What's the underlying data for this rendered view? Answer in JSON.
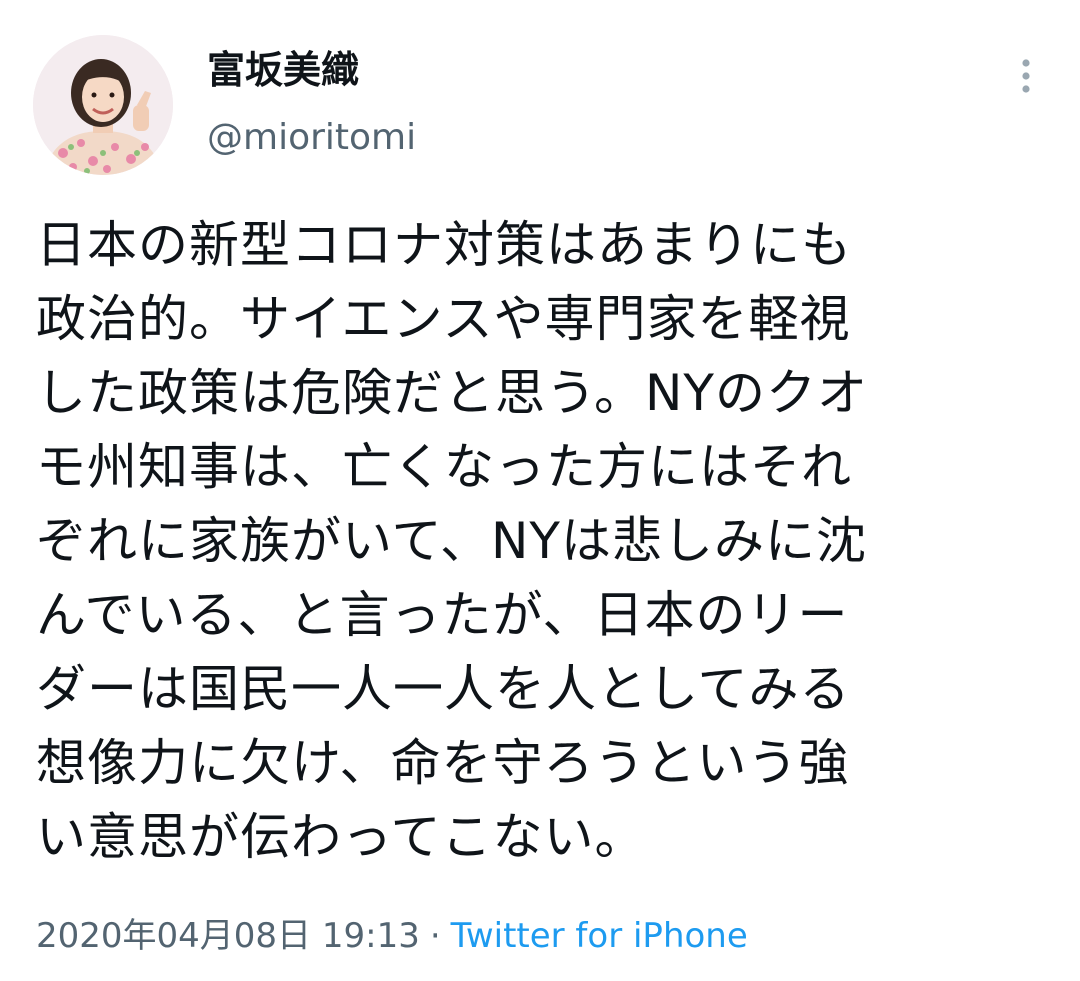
{
  "user": {
    "display_name": "富坂美織",
    "handle": "@mioritomi",
    "avatar_icon": "profile-photo"
  },
  "more_icon": "more-vertical-icon",
  "tweet": {
    "lines": [
      "日本の新型コロナ対策はあまりにも",
      "政治的。サイエンスや専門家を軽視",
      "した政策は危険だと思う。NYのクオ",
      "モ州知事は、亡くなった方にはそれ",
      "ぞれに家族がいて、NYは悲しみに沈",
      "んでいる、と言ったが、日本のリー",
      "ダーは国民一人一人を人としてみる",
      "想像力に欠け、命を守ろうという強",
      "い意思が伝わってこない。"
    ]
  },
  "meta": {
    "timestamp": "2020年04月08日 19:13",
    "separator": "·",
    "source": "Twitter for iPhone"
  },
  "colors": {
    "text": "#0f1419",
    "secondary": "#536471",
    "link": "#1d9bf0"
  }
}
